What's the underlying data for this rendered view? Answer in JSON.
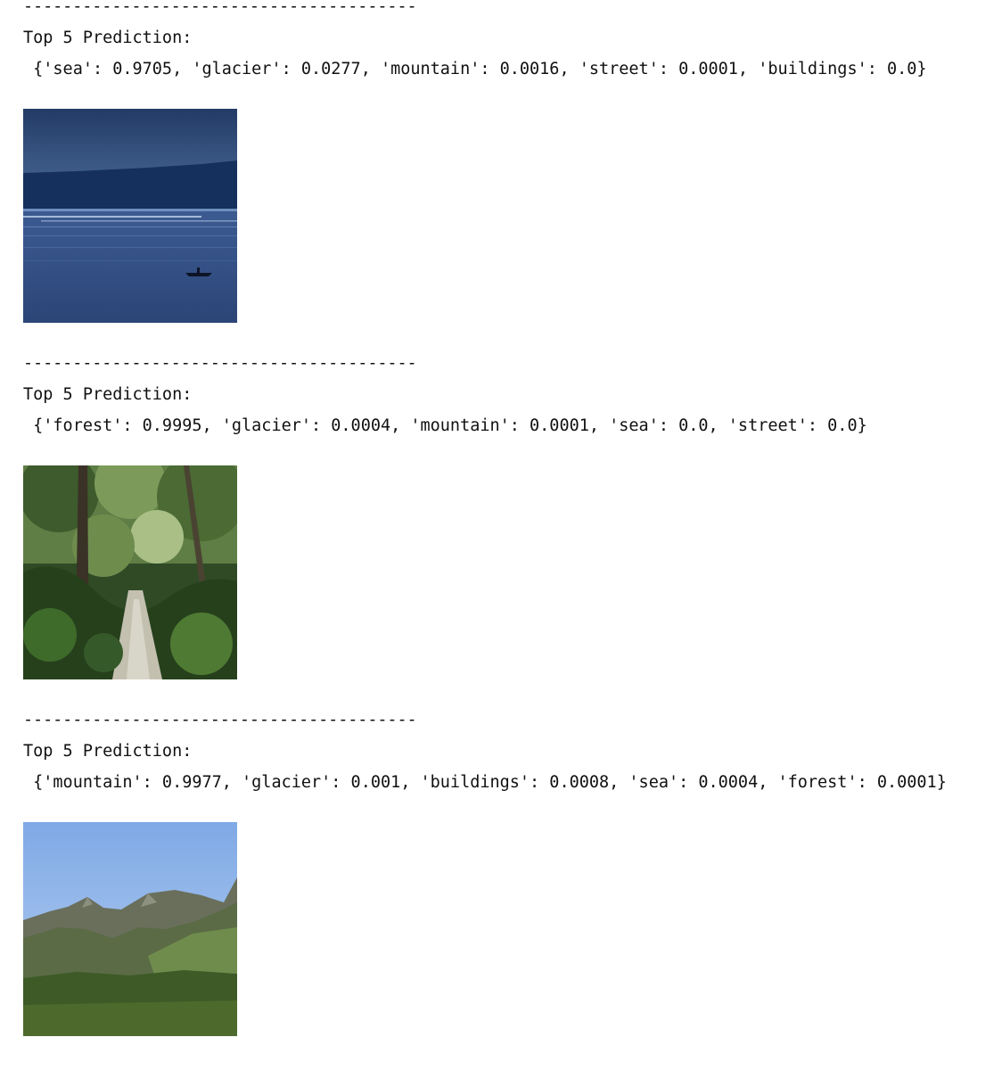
{
  "separator": "----------------------------------------",
  "heading": "Top 5 Prediction:",
  "outputs": [
    {
      "prediction": " {'sea': 0.9705, 'glacier': 0.0277, 'mountain': 0.0016, 'street': 0.0001, 'buildings': 0.0}",
      "image": "sea-scene-image"
    },
    {
      "prediction": " {'forest': 0.9995, 'glacier': 0.0004, 'mountain': 0.0001, 'sea': 0.0, 'street': 0.0}",
      "image": "forest-path-image"
    },
    {
      "prediction": " {'mountain': 0.9977, 'glacier': 0.001, 'buildings': 0.0008, 'sea': 0.0004, 'forest': 0.0001}",
      "image": "mountain-landscape-image"
    }
  ]
}
